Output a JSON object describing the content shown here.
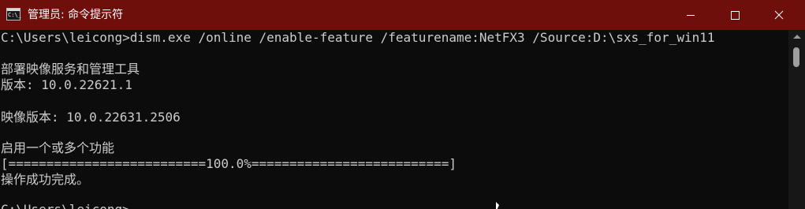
{
  "window": {
    "title": "管理员: 命令提示符",
    "icon": "console-icon",
    "icon_prompt": "C:\\_",
    "titlebar_color": "#6e0f0b",
    "buttons": {
      "minimize": "minimize-icon",
      "maximize": "maximize-icon",
      "close": "close-icon"
    }
  },
  "console": {
    "background": "#0c0c0c",
    "text_color": "#cccccc",
    "lines": [
      "C:\\Users\\leicong>dism.exe /online /enable-feature /featurename:NetFX3 /Source:D:\\sxs_for_win11",
      "部署映像服务和管理工具",
      "版本: 10.0.22621.1",
      "映像版本: 10.0.22631.2506",
      "启用一个或多个功能",
      "[==========================100.0%==========================]",
      "操作成功完成。",
      "C:\\Users\\leicong>"
    ]
  }
}
